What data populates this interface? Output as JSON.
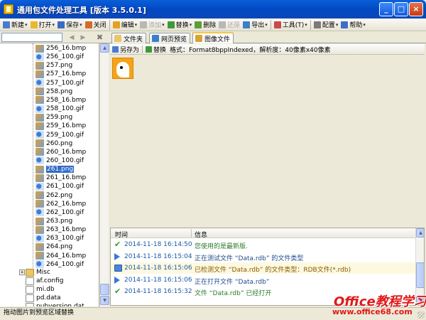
{
  "window": {
    "title": "通用包文件处理工具 [版本 3.5.0.1]",
    "controls": {
      "minimize": "_",
      "maximize": "□",
      "close": "×"
    }
  },
  "toolbar": {
    "items": [
      {
        "label": "新建",
        "icon": "new-icon",
        "color": "#4a7bd1",
        "caret": true,
        "enabled": true
      },
      {
        "label": "打开",
        "icon": "folder-open-icon",
        "color": "#e8b830",
        "caret": true,
        "enabled": true
      },
      {
        "label": "保存",
        "icon": "save-icon",
        "color": "#3b6bc4",
        "caret": true,
        "enabled": true
      },
      {
        "label": "关闭",
        "icon": "close-file-icon",
        "color": "#d46a2a",
        "caret": false,
        "enabled": true
      },
      {
        "label": "编辑",
        "icon": "edit-icon",
        "color": "#e3a21e",
        "caret": true,
        "enabled": true
      },
      {
        "label": "添加",
        "icon": "add-icon",
        "color": "#b8b8b8",
        "caret": true,
        "enabled": false
      },
      {
        "label": "替换",
        "icon": "replace-icon",
        "color": "#3c9a3c",
        "caret": true,
        "enabled": true
      },
      {
        "label": "删除",
        "icon": "delete-icon",
        "color": "#5a9e3a",
        "caret": false,
        "enabled": true
      },
      {
        "label": "还原",
        "icon": "restore-icon",
        "color": "#b8b8b8",
        "caret": false,
        "enabled": false
      },
      {
        "label": "导出",
        "icon": "export-icon",
        "color": "#3a80c8",
        "caret": true,
        "enabled": true
      },
      {
        "label": "工具(T)",
        "icon": "tools-icon",
        "color": "#c84a4a",
        "caret": true,
        "enabled": true
      },
      {
        "label": "配置",
        "icon": "gear-icon",
        "color": "#7a7a7a",
        "caret": true,
        "enabled": true
      },
      {
        "label": "帮助",
        "icon": "help-icon",
        "color": "#3a6fc8",
        "caret": true,
        "enabled": true
      }
    ]
  },
  "left_panel": {
    "nav": {
      "back": "◀",
      "forward": "▶",
      "close": "✖"
    },
    "tree": [
      {
        "label": "256_16.bmp",
        "kind": "img"
      },
      {
        "label": "256_100.gif",
        "kind": "gif"
      },
      {
        "label": "257.png",
        "kind": "img"
      },
      {
        "label": "257_16.bmp",
        "kind": "img"
      },
      {
        "label": "257_100.gif",
        "kind": "gif"
      },
      {
        "label": "258.png",
        "kind": "img"
      },
      {
        "label": "258_16.bmp",
        "kind": "img"
      },
      {
        "label": "258_100.gif",
        "kind": "gif"
      },
      {
        "label": "259.png",
        "kind": "img"
      },
      {
        "label": "259_16.bmp",
        "kind": "img"
      },
      {
        "label": "259_100.gif",
        "kind": "gif"
      },
      {
        "label": "260.png",
        "kind": "img"
      },
      {
        "label": "260_16.bmp",
        "kind": "img"
      },
      {
        "label": "260_100.gif",
        "kind": "gif"
      },
      {
        "label": "261.png",
        "kind": "img",
        "selected": true
      },
      {
        "label": "261_16.bmp",
        "kind": "img"
      },
      {
        "label": "261_100.gif",
        "kind": "gif"
      },
      {
        "label": "262.png",
        "kind": "img"
      },
      {
        "label": "262_16.bmp",
        "kind": "img"
      },
      {
        "label": "262_100.gif",
        "kind": "gif"
      },
      {
        "label": "263.png",
        "kind": "img"
      },
      {
        "label": "263_16.bmp",
        "kind": "img"
      },
      {
        "label": "263_100.gif",
        "kind": "gif"
      },
      {
        "label": "264.png",
        "kind": "img"
      },
      {
        "label": "264_16.bmp",
        "kind": "img"
      },
      {
        "label": "264_100.gif",
        "kind": "gif"
      }
    ],
    "root_items": [
      {
        "label": "Misc",
        "kind": "folder"
      },
      {
        "label": "af.config",
        "kind": "doc"
      },
      {
        "label": "mi.db",
        "kind": "doc"
      },
      {
        "label": "pd.data",
        "kind": "doc"
      },
      {
        "label": "pubversion.dat",
        "kind": "doc"
      }
    ]
  },
  "tabs": [
    {
      "label": "文件夹",
      "icon": "folder-icon",
      "color": "#e9c667",
      "active": false
    },
    {
      "label": "网页预览",
      "icon": "globe-icon",
      "color": "#3a80c8",
      "active": false
    },
    {
      "label": "图像文件",
      "icon": "image-icon",
      "color": "#d9a23a",
      "active": true
    }
  ],
  "image_toolbar": {
    "save_as": "另存为",
    "replace": "替换",
    "info": "格式：Format8bppIndexed，解析度：40像素x40像素"
  },
  "log": {
    "headers": {
      "time": "时间",
      "info": "信息"
    },
    "rows": [
      {
        "icon": "check-icon",
        "time": "2014-11-18 16:14:50",
        "msg": "您使用的是最新版.",
        "msg_color": "#2d7a2d",
        "bg": "#ffffff"
      },
      {
        "icon": "arrow-icon",
        "time": "2014-11-18 16:15:04",
        "msg": "正在测试文件 “Data.rdb” 的文件类型",
        "msg_color": "#1c4a8c",
        "bg": "#ffffff"
      },
      {
        "icon": "monitor-icon",
        "time": "2014-11-18 16:15:06",
        "msg": "已检测文件 “Data.rdb” 的文件类型：RDB文件(*.rdb)",
        "msg_color": "#8a5a00",
        "bg": "#fdf9e0"
      },
      {
        "icon": "arrow-icon",
        "time": "2014-11-18 16:15:06",
        "msg": "正在打开文件 “Data.rdb”",
        "msg_color": "#1c4a8c",
        "bg": "#ffffff"
      },
      {
        "icon": "check-icon",
        "time": "2014-11-18 16:15:32",
        "msg": "文件 “Data.rdb” 已经打开",
        "msg_color": "#2d7a2d",
        "bg": "#ffffff"
      }
    ]
  },
  "status": {
    "text": "拖动图片到预览区域替换"
  },
  "watermark": {
    "brand": "Office教程学习网",
    "url": "www.office68.com"
  }
}
